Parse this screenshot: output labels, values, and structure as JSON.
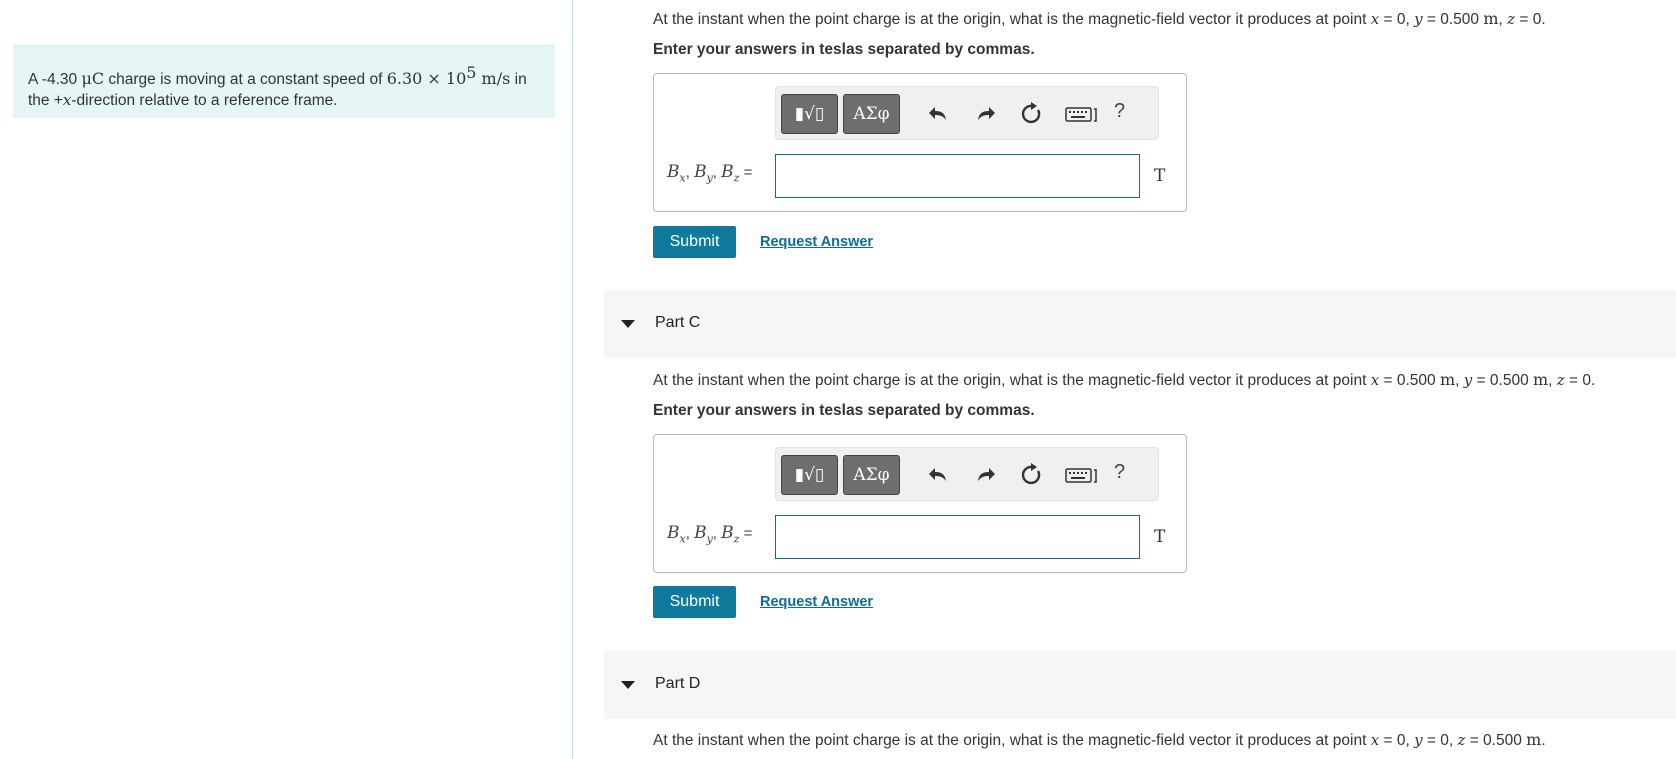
{
  "problem": {
    "prefix": "A -4.30 ",
    "unit_charge": "μC",
    "mid": " charge is moving at a constant speed of ",
    "speed_mantissa": "6.30 × 10",
    "speed_exp": "5",
    "speed_unit": " m/s",
    "line_end": " in",
    "line2_prefix": "the +",
    "axis_var": "x",
    "line2_suffix": "-direction relative to a reference frame."
  },
  "partB": {
    "question_start": "At the instant when the point charge is at the origin, what is the magnetic-field vector it produces at point ",
    "coords": [
      {
        "var": "x",
        "eq": " = 0, "
      },
      {
        "var": "y",
        "eq": " = 0.500 ",
        "unit": "m",
        "sep": ", "
      },
      {
        "var": "z",
        "eq": " = 0."
      }
    ],
    "instruction": "Enter your answers in teslas separated by commas.",
    "input_value": "",
    "unit": "T",
    "submit_label": "Submit",
    "request_label": "Request Answer"
  },
  "partC": {
    "header": "Part C",
    "question_start": "At the instant when the point charge is at the origin, what is the magnetic-field vector it produces at point ",
    "coords": [
      {
        "var": "x",
        "eq": " = 0.500 ",
        "unit": "m",
        "sep": ", "
      },
      {
        "var": "y",
        "eq": " = 0.500 ",
        "unit": "m",
        "sep": ", "
      },
      {
        "var": "z",
        "eq": " = 0."
      }
    ],
    "instruction": "Enter your answers in teslas separated by commas.",
    "input_value": "",
    "unit": "T",
    "submit_label": "Submit",
    "request_label": "Request Answer"
  },
  "partD": {
    "header": "Part D",
    "question_start": "At the instant when the point charge is at the origin, what is the magnetic-field vector it produces at point ",
    "coords": [
      {
        "var": "x",
        "eq": " = 0, "
      },
      {
        "var": "y",
        "eq": " = 0, "
      },
      {
        "var": "z",
        "eq": " = 0.500 ",
        "unit": "m",
        "sep": "."
      }
    ]
  },
  "answer_label": {
    "B": "B",
    "subs": [
      "x",
      "y",
      "z"
    ],
    "sep": ", ",
    "equals": " ="
  },
  "toolbar": {
    "templates_glyph": "▮√▯",
    "greek_glyph": "ΑΣφ",
    "help": "?",
    "icons": [
      "templates-icon",
      "greek-letters-icon",
      "undo-icon",
      "redo-icon",
      "reset-icon",
      "keyboard-icon",
      "help-icon"
    ]
  },
  "colors": {
    "accent": "#0f7a9c",
    "link": "#0a6e96",
    "problem_bg": "#e6f5f5",
    "part_header_bg": "#f6f6f6",
    "input_border": "#0f6c8c"
  }
}
